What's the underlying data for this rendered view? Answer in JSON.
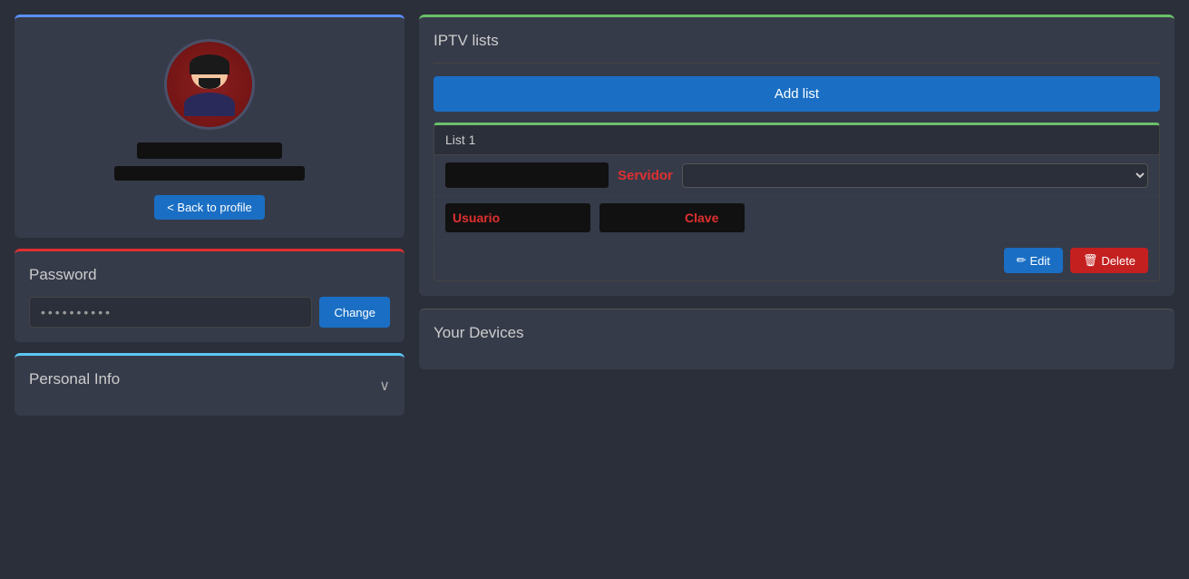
{
  "profile": {
    "username_placeholder": "████████████████",
    "email_placeholder": "█████████████████████",
    "back_button_label": "< Back to profile"
  },
  "password_section": {
    "title": "Password",
    "dots": "• • • • • • • • • •",
    "change_button": "Change"
  },
  "personal_info": {
    "title": "Personal Info",
    "chevron": "∨"
  },
  "iptv": {
    "title": "IPTV lists",
    "add_button": "Add list",
    "list1": {
      "header": "List 1",
      "servidor_label": "Servidor",
      "usuario_label": "Usuario",
      "clave_label": "Clave",
      "edit_button": "Edit",
      "delete_button": "Delete"
    }
  },
  "devices": {
    "title": "Your Devices"
  },
  "colors": {
    "blue_accent": "#5b8fff",
    "red_accent": "#e03030",
    "cyan_accent": "#5bc8f5",
    "green_accent": "#6abf69",
    "bg_dark": "#2b2f3a",
    "bg_card": "#363b4a"
  }
}
